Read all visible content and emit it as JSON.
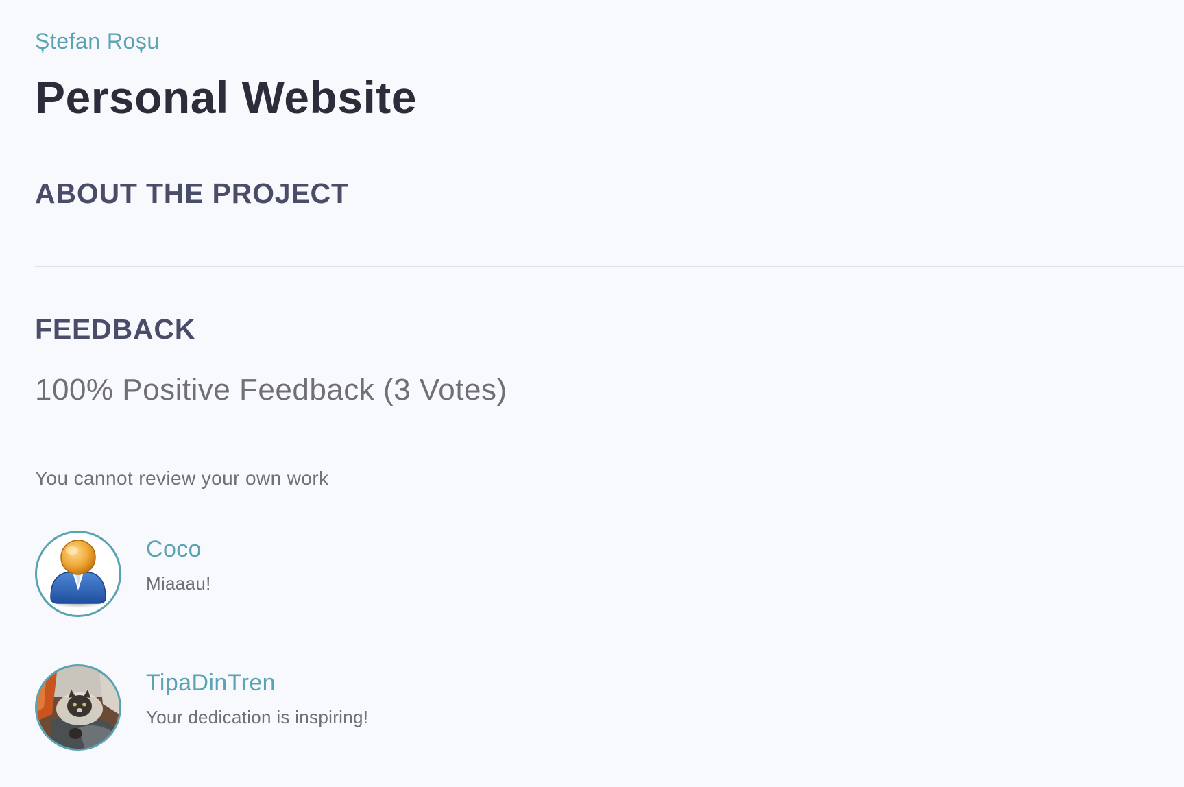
{
  "header": {
    "author": "Ștefan Roșu",
    "title": "Personal Website"
  },
  "about": {
    "heading": "ABOUT THE PROJECT"
  },
  "feedback": {
    "heading": "FEEDBACK",
    "summary": "100% Positive Feedback (3 Votes)",
    "positive_fraction": 1.0,
    "votes": 3,
    "notice": "You cannot review your own work",
    "reviews": [
      {
        "name": "Coco",
        "text": "Miaaau!",
        "avatar": "default-user-icon"
      },
      {
        "name": "TipaDinTren",
        "text": "Your dedication is inspiring!",
        "avatar": "cat-photo"
      }
    ]
  },
  "colors": {
    "accent": "#5aa3b3",
    "title": "#2b2d3a",
    "heading": "#4a4d68",
    "muted_text": "#6f6f75",
    "background": "#f8f9fc",
    "divider": "#dfe2e8"
  }
}
